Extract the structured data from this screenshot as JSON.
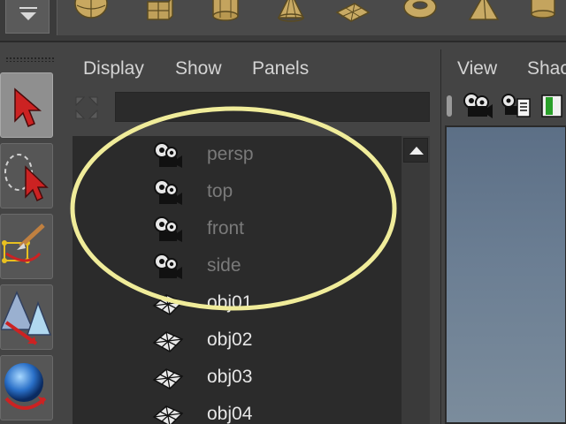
{
  "top_shelf": {
    "menu_button": "shelf-menu-button",
    "icons": [
      "sphere-icon",
      "cube-icon",
      "cylinder-icon",
      "cone-icon",
      "plane-icon",
      "torus-icon",
      "pyramid-icon",
      "pipe-icon"
    ]
  },
  "toolbox": {
    "tools": [
      {
        "name": "select-tool",
        "icon": "arrow-cursor-icon",
        "active": true
      },
      {
        "name": "lasso-tool",
        "icon": "lasso-icon",
        "active": false
      },
      {
        "name": "paint-select-tool",
        "icon": "brush-icon",
        "active": false
      },
      {
        "name": "move-tool",
        "icon": "move-icon",
        "active": false
      },
      {
        "name": "rotate-tool",
        "icon": "rotate-sphere-icon",
        "active": false
      }
    ]
  },
  "outliner": {
    "menus": [
      "Display",
      "Show",
      "Panels"
    ],
    "search_value": "",
    "items": [
      {
        "label": "persp",
        "kind": "camera",
        "icon": "camera-icon"
      },
      {
        "label": "top",
        "kind": "camera",
        "icon": "camera-icon"
      },
      {
        "label": "front",
        "kind": "camera",
        "icon": "camera-icon"
      },
      {
        "label": "side",
        "kind": "camera",
        "icon": "camera-icon"
      },
      {
        "label": "obj01",
        "kind": "mesh",
        "icon": "mesh-icon"
      },
      {
        "label": "obj02",
        "kind": "mesh",
        "icon": "mesh-icon"
      },
      {
        "label": "obj03",
        "kind": "mesh",
        "icon": "mesh-icon"
      },
      {
        "label": "obj04",
        "kind": "mesh",
        "icon": "mesh-icon"
      }
    ]
  },
  "viewport": {
    "menus": [
      "View",
      "Shac"
    ],
    "toolbar_icons": [
      "camera-icon",
      "camera-attributes-icon",
      "bookmark-icon"
    ]
  },
  "colors": {
    "annotation": "#f0ec9a",
    "viewport_top": "#5c6f86",
    "viewport_bottom": "#7b8c9c",
    "camera_label": "#7a7a7a",
    "mesh_label": "#e6e6e6"
  }
}
